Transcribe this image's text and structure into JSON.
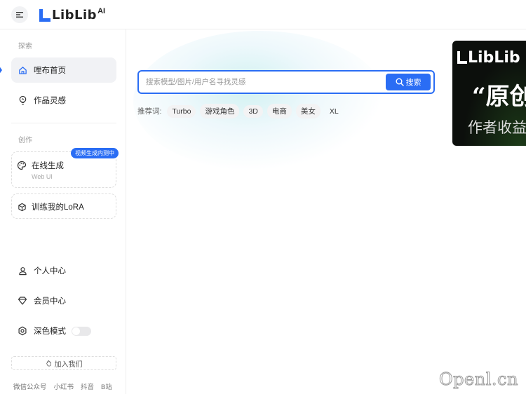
{
  "header": {
    "logo_text": "LibLib",
    "logo_suffix": "AI",
    "menu_icon": "menu-icon"
  },
  "sidebar": {
    "explore_label": "探索",
    "items": [
      {
        "label": "哩布首页",
        "icon": "home-icon"
      },
      {
        "label": "作品灵感",
        "icon": "lightbulb-icon"
      }
    ],
    "create_label": "创作",
    "online_gen": {
      "label": "在线生成",
      "sub": "Web UI",
      "badge": "视频生成内测中",
      "icon": "palette-icon"
    },
    "train_lora": {
      "label": "训练我的LoRA",
      "icon": "cube-icon"
    },
    "bottom_items": [
      {
        "label": "个人中心",
        "icon": "user-icon"
      },
      {
        "label": "会员中心",
        "icon": "diamond-icon"
      }
    ],
    "dark_mode": {
      "label": "深色模式",
      "icon": "settings-icon",
      "enabled": false
    },
    "join_label": "加入我们",
    "footer_links": [
      "微信公众号",
      "小红书",
      "抖音",
      "B站"
    ]
  },
  "search": {
    "placeholder": "搜索模型/图片/用户名寻找灵感",
    "button_label": "搜索",
    "recommend_label": "推荐词:",
    "tags": [
      "Turbo",
      "游戏角色",
      "3D",
      "电商",
      "美女",
      "XL"
    ]
  },
  "banner": {
    "logo": "LibLib",
    "quote": "“原创",
    "sub": "作者收益"
  },
  "watermark": "Openl.cn",
  "colors": {
    "accent": "#2a6df4"
  }
}
